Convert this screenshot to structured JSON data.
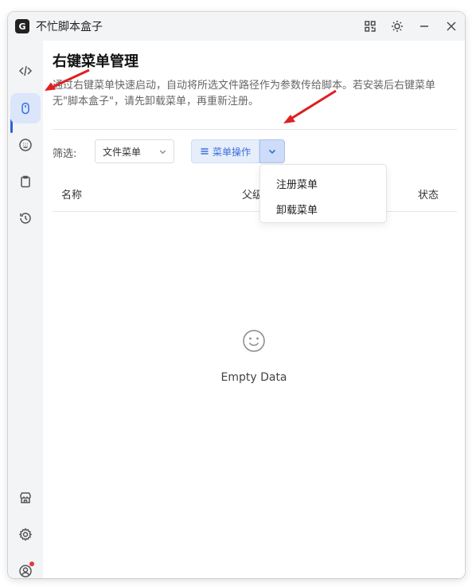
{
  "window": {
    "title": "不忙脚本盒子",
    "logo_text": "G"
  },
  "titlebar_icons": [
    "grid-icon",
    "sun-icon",
    "minimize-icon",
    "close-icon"
  ],
  "sidebar": {
    "items": [
      {
        "icon": "code-icon",
        "active": false
      },
      {
        "icon": "mouse-icon",
        "active": true
      },
      {
        "icon": "keyboard-icon",
        "active": false
      },
      {
        "icon": "clipboard-icon",
        "active": false
      },
      {
        "icon": "history-icon",
        "active": false
      }
    ],
    "bottom_items": [
      {
        "icon": "store-icon"
      },
      {
        "icon": "settings-icon"
      },
      {
        "icon": "user-icon",
        "has_badge": true
      }
    ]
  },
  "main": {
    "title": "右键菜单管理",
    "description": "通过右键菜单快速启动，自动将所选文件路径作为参数传给脚本。若安装后右键菜单无\"脚本盒子\"，请先卸载菜单，再重新注册。",
    "filter": {
      "label": "筛选:",
      "selected": "文件菜单"
    },
    "menu_ops": {
      "label": "菜单操作",
      "dropdown": [
        "注册菜单",
        "卸载菜单"
      ]
    },
    "table": {
      "columns": [
        "名称",
        "父级",
        "状态"
      ]
    },
    "empty_text": "Empty Data"
  },
  "colors": {
    "accent": "#3b6fd8",
    "annotation_arrow": "#e02020"
  }
}
